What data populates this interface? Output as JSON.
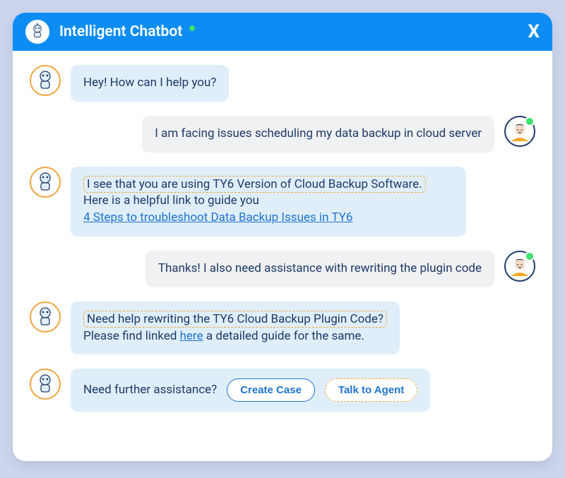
{
  "header": {
    "title": "Intelligent Chatbot",
    "close_label": "X"
  },
  "messages": [
    {
      "from": "bot",
      "text": "Hey! How can I help you?"
    },
    {
      "from": "user",
      "text": "I am facing issues scheduling my data backup in cloud server"
    },
    {
      "from": "bot",
      "dashed_text": "I see that you are using TY6 Version of Cloud Backup Software.",
      "plain_after_dashed": " Here is a helpful link to guide you",
      "link_text": "4 Steps to troubleshoot Data Backup Issues in TY6"
    },
    {
      "from": "user",
      "text": "Thanks! I also need assistance with rewriting the plugin code"
    },
    {
      "from": "bot",
      "dashed_text": "Need help rewriting the TY6 Cloud Backup Plugin Code?",
      "plain_line2_prefix": "Please find linked ",
      "plain_line2_link": "here",
      "plain_line2_suffix": " a detailed guide for the same."
    }
  ],
  "footer": {
    "assist_text": "Need further assistance?",
    "create_case_label": "Create Case",
    "talk_agent_label": "Talk to Agent"
  },
  "icons": {
    "bot": "robot-head-icon",
    "user": "person-avatar-icon"
  }
}
